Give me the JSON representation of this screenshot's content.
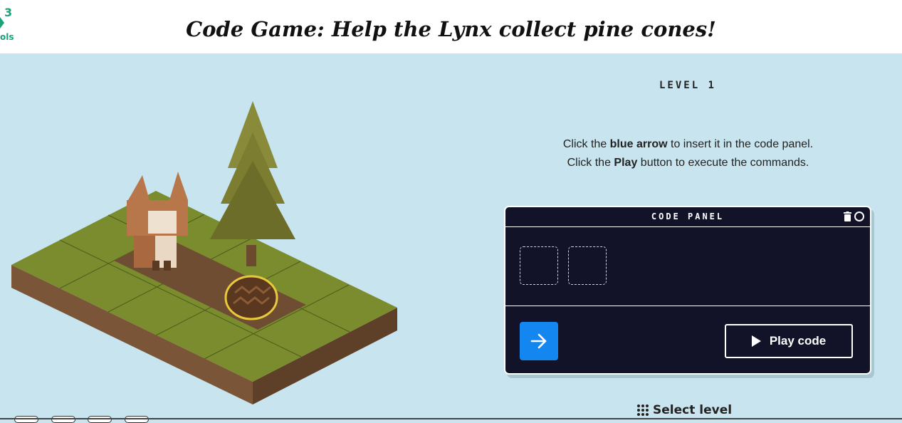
{
  "header": {
    "logo_number": "3",
    "logo_text": "ols",
    "title": "Code Game: Help the Lynx collect pine cones!"
  },
  "game": {
    "level_label": "LEVEL 1",
    "instructions": {
      "line1_pre": "Click the ",
      "line1_bold": "blue arrow",
      "line1_post": " to insert it in the code panel.",
      "line2_pre": "Click the ",
      "line2_bold": "Play",
      "line2_post": " button to execute the commands."
    },
    "code_panel": {
      "title": "CODE PANEL",
      "slots": 2
    },
    "command": {
      "icon": "arrow-right-icon"
    },
    "play_label": "Play code",
    "select_level_label": "Select level"
  },
  "colors": {
    "background": "#c8e5ef",
    "panel": "#121228",
    "accent_blue": "#1486f0",
    "grass": "#7a8c2e",
    "logo_green": "#1aa37a"
  }
}
